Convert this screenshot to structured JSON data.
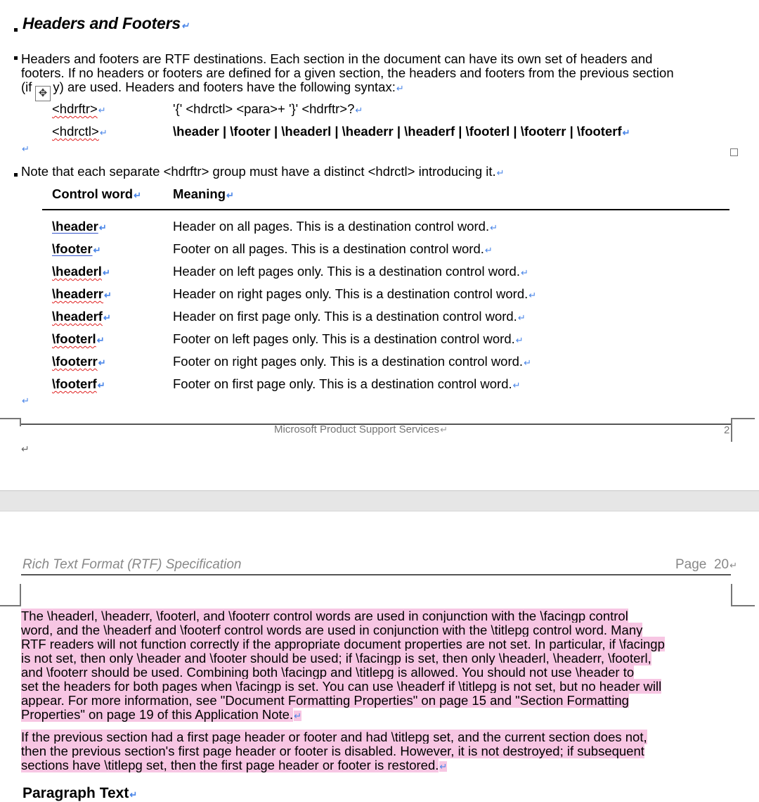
{
  "section": {
    "heading": "Headers and Footers",
    "intro": "Headers and footers are RTF destinations. Each section in the document can have its own set of headers and footers. If no headers or footers are defined for a given section, the headers and footers from the previous section (if any) are used. Headers and footers have the following syntax:",
    "intro_l1": "Headers and footers are RTF destinations. Each section in the document can have its own set of headers and",
    "intro_l2": "footers. If no headers or footers are defined for a given section, the headers and footers from the previous section",
    "intro_l3a": "(if",
    "intro_l3b": "y) are used. Headers and footers have the following syntax:",
    "syntax": [
      {
        "term": "<hdrftr>",
        "definition": "'{' <hdrctl> <para>+ '}' <hdrftr>?"
      },
      {
        "term": "<hdrctl>",
        "definition": "\\header | \\footer | \\headerl | \\headerr | \\headerf | \\footerl | \\footerr | \\footerf"
      }
    ],
    "note": "Note that each separate <hdrftr> group must have a distinct <hdrctl> introducing it."
  },
  "table": {
    "headers": [
      "Control word",
      "Meaning"
    ],
    "rows": [
      {
        "word": "\\header",
        "meaning": "Header on all pages. This is a destination control word."
      },
      {
        "word": "\\footer",
        "meaning": "Footer on all pages. This is a destination control word."
      },
      {
        "word": "\\headerl",
        "meaning": "Header on left pages only. This is a destination control word."
      },
      {
        "word": "\\headerr",
        "meaning": "Header on right pages only. This is a destination control word."
      },
      {
        "word": "\\headerf",
        "meaning": "Header on first page only. This is a destination control word."
      },
      {
        "word": "\\footerl",
        "meaning": "Footer on left pages only. This is a destination control word."
      },
      {
        "word": "\\footerr",
        "meaning": "Footer on right pages only. This is a destination control word."
      },
      {
        "word": "\\footerf",
        "meaning": "Footer on first page only. This is a destination control word."
      }
    ]
  },
  "page1_footer": {
    "center": "Microsoft Product Support Services",
    "page_number": "2"
  },
  "page2_header": {
    "title": "Rich Text Format (RTF) Specification",
    "page_label": "Page",
    "page_number": "20"
  },
  "body": {
    "p1_lines": [
      "The \\headerl, \\headerr, \\footerl, and \\footerr control words are used in conjunction with the \\facingp control",
      "word, and the \\headerf and \\footerf control words are used in conjunction with the \\titlepg control word. Many",
      "RTF readers will not function correctly if the appropriate document properties are not set. In particular, if \\facingp",
      "is not set, then only \\header and \\footer should be used; if \\facingp is set, then only \\headerl, \\headerr, \\footerl,",
      "and \\footerr should be used.    Combining both \\facingp and \\titlepg is allowed. You should not use \\header to",
      "set the headers for both pages when \\facingp is set. You can use \\headerf if \\titlepg is not set, but no header will",
      "appear. For more information, see \"Document Formatting Properties\" on page 15 and \"Section Formatting",
      "Properties\" on page 19 of this Application Note."
    ],
    "p2_lines": [
      "If the previous section had a first page header or footer and had \\titlepg set, and the current section does not,",
      "then the previous section's first page header or footer is disabled. However, it is not destroyed; if subsequent",
      "sections have \\titlepg set, then the first page header or footer is restored."
    ],
    "next_heading": "Paragraph Text"
  },
  "colors": {
    "highlight": "#f7c6e3",
    "paragraph_mark": "#4a86e8",
    "page_gap": "#e6e6e6"
  }
}
